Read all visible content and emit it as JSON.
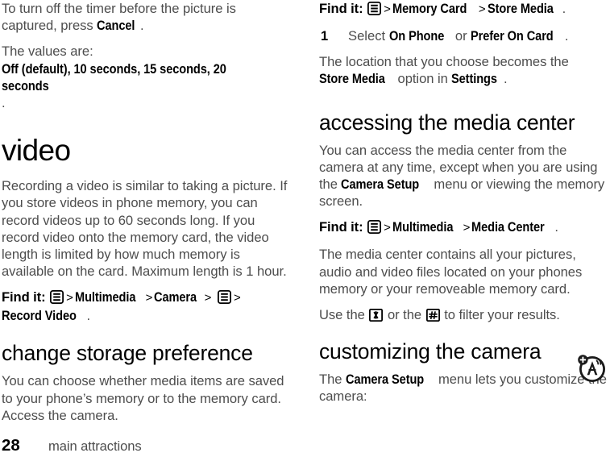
{
  "document": {
    "title": "main attractions",
    "page_number": "28",
    "footer_chapter": "main attractions"
  },
  "icons": {
    "menu_key": "menu-key-icon",
    "star_key": "star-key-icon",
    "pound_key": "pound-key-icon",
    "corner": "antenna-accessibility-icon"
  },
  "left_column": {
    "p_timer": {
      "t1": "To turn off the timer before the picture is captured, press ",
      "b1": "Cancel",
      "t2": "."
    },
    "p_values": {
      "t1": "The values are: ",
      "b1": "Off (default), 10 seconds, 15 seconds, 20 seconds",
      "t2": "."
    },
    "heading_video": "video",
    "p_recording": "Recording a video is similar to taking a picture. If you store videos in phone memory, you can record videos up to 60 seconds long. If you record video onto the memory card, the video length is limited by how much memory is available on the card.  Maximum length is 1 hour.",
    "findit_video": {
      "lead": "Find it:",
      "items": [
        "Multimedia",
        "Camera",
        "Record Video"
      ],
      "sep": ">",
      "trailing": "."
    },
    "heading_storage": "change storage preference",
    "p_storage": "You can choose whether media items are saved to your phone’s memory or to the memory card. Access the camera."
  },
  "right_column": {
    "findit_memory": {
      "lead": "Find it:",
      "items": [
        "Memory Card",
        "Store Media"
      ],
      "sep": ">",
      "trailing": "."
    },
    "step1": {
      "num": "1",
      "t1": "Select ",
      "b1": "On Phone",
      "t2": " or ",
      "b2": "Prefer On Card",
      "t3": "."
    },
    "p_location": {
      "t1": "The location that you choose becomes the ",
      "b1": "Store Media",
      "t2": " option in ",
      "b2": "Settings",
      "t3": "."
    },
    "heading_media_center": "accessing the media center",
    "p_access": {
      "t1": "You can access the media center from the camera at any time, except when you are using the ",
      "b1": "Camera Setup",
      "t2": " menu or viewing the memory screen."
    },
    "findit_media_center": {
      "lead": "Find it:",
      "items": [
        "Multimedia",
        "Media Center"
      ],
      "sep": ">",
      "trailing": "."
    },
    "p_contains": "The media center contains all your pictures, audio and video files located on your phones memory or your removeable memory card.",
    "p_filter": {
      "t1": "Use the ",
      "t2": " or the ",
      "t3": "  to filter your results."
    },
    "heading_customizing": "customizing the camera",
    "p_customize": {
      "t1": "The ",
      "b1": "Camera Setup",
      "t2": " menu lets you customize the camera:"
    }
  }
}
